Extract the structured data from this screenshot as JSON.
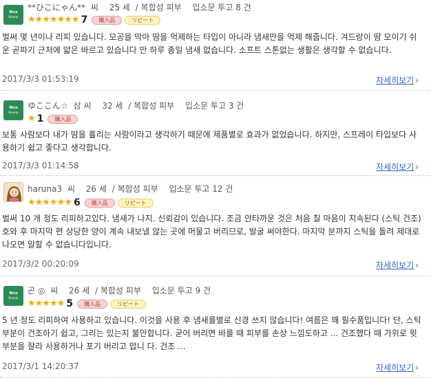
{
  "reviews": [
    {
      "nickname": "**ひこにゃん**",
      "honorific": "씨",
      "age": "25 세",
      "skin": "/ 복합성 피부",
      "posts": "입소문 투고 8 건",
      "stars": "★★★★★★★",
      "score": "7",
      "badges": [
        "購入品",
        "リピート"
      ],
      "text": "벌써 몇 년이나 리피 있습니다. 모공을 막아 땀을 억제하는 타입이 아니라 냄새만을 억제 해줍니다. 겨드랑이 땀 모이기 쉬운 곧파기 근처에 얇은 바르고 있습니다 만 하루 종일 냄새 없습니다. 소프트 스톤없는 생활은 생각할 수 없습니다.",
      "date": "2017/3/3 01:53:19",
      "more": "자세히보기"
    },
    {
      "nickname": "ゆここん☆",
      "honorific": "삼 씨",
      "age": "32 세",
      "skin": "/ 복합성 피부",
      "posts": "입소문 투고 3 건",
      "stars": "★",
      "score": "1",
      "badges": [
        "購入品"
      ],
      "text": "보통 사람보다 내가 땀을 흘리는 사람이라고 생각하기 때문에 제품별로 효과가 없었습니다. 하지만, 스프레이 타입보다 사용하기 쉽고 좋다고 생각합니다.",
      "date": "2017/3/3 01:14:58",
      "more": "자세히보기"
    },
    {
      "nickname": "haruna3",
      "honorific": "씨",
      "age": "26 세",
      "skin": "/ 복합성 피부",
      "posts": "입소문 투고 12 건",
      "stars": "★★★★★★",
      "score": "6",
      "badges": [
        "購入品",
        "リピート"
      ],
      "text": "벌써 10 개 정도 리피하고있다. 냄새가 나지. 신뢰감이 있습니다. 조금 안타까운 것은 처음 칠 마음이 지속된다 (스틱 건조) 호와 후 마지막 편 상당한 양이 계속 내보낼 않는 곳에 머물고 버리므로, 발굴 써야한다. 마지막 분까지 스틱을 돌려 제대로 나오면 말할 수 없습니다입니다.",
      "date": "2017/3/2 00:20:09",
      "more": "자세히보기"
    },
    {
      "nickname": "곤 ◎",
      "honorific": "씨",
      "age": "26 세",
      "skin": "/ 복합성 피부",
      "posts": "입소문 투고 9 건",
      "stars": "★★★★★",
      "score": "5",
      "badges": [
        "購入品",
        "リピート"
      ],
      "text": "5 년 정도 리피하여 사용하고 있습니다. 이것을 사용 후 냄새를별로 신경 쓰지 않습니다! 여름은 꽤 필수품입니다! 단, 스틱 부분이 건조하기 쉽고, 그리는 있는지 불안합니다. 굳어 버리면 바를 때 피부를 손상 느낌도하고 ... 건조했다 때 가위로 윗부분을 잘라 사용하거나 포기 버리고 맙니 다. 건조 ...",
      "date": "2017/3/1 14:20:37",
      "more": "자세히보기"
    }
  ],
  "avatar_labels": [
    "Nice",
    "Beauty"
  ]
}
